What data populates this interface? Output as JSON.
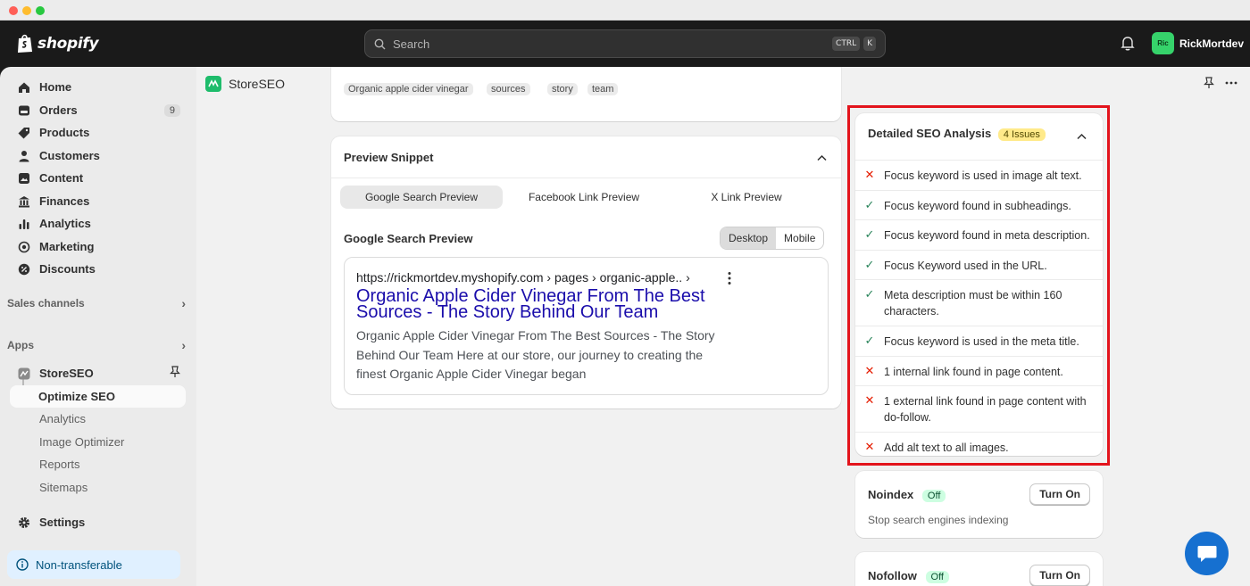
{
  "topbar": {
    "logo_text": "shopify",
    "search_placeholder": "Search",
    "shortcut_keys": [
      "CTRL",
      "K"
    ],
    "user_initials": "Ric",
    "user_name": "RickMortdev"
  },
  "sidebar": {
    "items": [
      {
        "label": "Home",
        "icon": "home-icon"
      },
      {
        "label": "Orders",
        "icon": "orders-icon",
        "count": "9"
      },
      {
        "label": "Products",
        "icon": "tag-icon"
      },
      {
        "label": "Customers",
        "icon": "person-icon"
      },
      {
        "label": "Content",
        "icon": "content-icon"
      },
      {
        "label": "Finances",
        "icon": "bank-icon"
      },
      {
        "label": "Analytics",
        "icon": "chart-icon"
      },
      {
        "label": "Marketing",
        "icon": "target-icon"
      },
      {
        "label": "Discounts",
        "icon": "discount-icon"
      }
    ],
    "sales_channels": "Sales channels",
    "apps": "Apps",
    "app_name": "StoreSEO",
    "app_subitems": [
      "Optimize SEO",
      "Analytics",
      "Image Optimizer",
      "Reports",
      "Sitemaps"
    ],
    "settings": "Settings",
    "non_transferable": "Non-transferable"
  },
  "app_header": {
    "title": "StoreSEO"
  },
  "tags": [
    "Organic apple cider vinegar",
    "sources",
    "story",
    "team"
  ],
  "preview": {
    "title": "Preview Snippet",
    "tabs": [
      "Google Search Preview",
      "Facebook Link Preview",
      "X Link Preview"
    ],
    "section_label": "Google Search Preview",
    "modes": [
      "Desktop",
      "Mobile"
    ],
    "serp_url": "https://rickmortdev.myshopify.com › pages › organic-apple.. ›",
    "serp_title": "Organic Apple Cider Vinegar From The Best Sources - The Story Behind Our Team",
    "serp_desc": "Organic Apple Cider Vinegar From The Best Sources - The Story Behind Our Team Here at our store, our journey to creating the finest Organic Apple Cider Vinegar began"
  },
  "analysis": {
    "title": "Detailed SEO Analysis",
    "issues_badge": "4 Issues",
    "checks": [
      {
        "text": "Focus keyword is used in image alt text.",
        "status": "fail"
      },
      {
        "text": "Focus keyword found in subheadings.",
        "status": "pass"
      },
      {
        "text": "Focus keyword found in meta description.",
        "status": "pass"
      },
      {
        "text": "Focus Keyword used in the URL.",
        "status": "pass"
      },
      {
        "text": "Meta description must be within 160 characters.",
        "status": "pass"
      },
      {
        "text": "Focus keyword is used in the meta title.",
        "status": "pass"
      },
      {
        "text": "1 internal link found in page content.",
        "status": "fail"
      },
      {
        "text": "1 external link found in page content with do-follow.",
        "status": "fail"
      },
      {
        "text": "Add alt text to all images.",
        "status": "fail"
      }
    ]
  },
  "noindex": {
    "title": "Noindex",
    "badge": "Off",
    "button": "Turn On",
    "subtitle": "Stop search engines indexing"
  },
  "nofollow": {
    "title": "Nofollow",
    "badge": "Off",
    "button": "Turn On"
  },
  "colors": {
    "fail": "#e51c00",
    "pass": "#29845a",
    "highlight": "#e3141c"
  }
}
